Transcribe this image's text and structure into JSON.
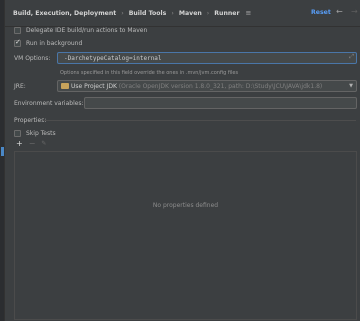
{
  "breadcrumb": {
    "items": [
      "Build, Execution, Deployment",
      "Build Tools",
      "Maven",
      "Runner"
    ],
    "separator": "›",
    "menu_icon": "≡"
  },
  "header": {
    "reset_label": "Reset",
    "back_icon": "←",
    "forward_icon": "→"
  },
  "options": {
    "delegate_label": "Delegate IDE build/run actions to Maven",
    "delegate_checked": false,
    "background_label": "Run in background",
    "background_checked": true
  },
  "vm_options": {
    "label": "VM Options:",
    "value": "-DarchetypeCatalog=internal",
    "hint": "Options specified in this field override the ones in .mvn/jvm.config files"
  },
  "jre": {
    "label": "JRE:",
    "selected_main": "Use Project JDK",
    "selected_detail": " (Oracle OpenJDK version 1.8.0_321, path: D:\\Study\\JCU\\JAVA\\jdk1.8)"
  },
  "env": {
    "label": "Environment variables:",
    "value": ""
  },
  "properties": {
    "label": "Properties:",
    "skip_tests_label": "Skip Tests",
    "skip_tests_checked": false,
    "add_icon": "+",
    "remove_icon": "−",
    "edit_icon": "✎",
    "empty_text": "No properties defined"
  },
  "colors": {
    "background": "#3c3f41",
    "accent": "#589df6",
    "folder": "#c8a35b"
  }
}
